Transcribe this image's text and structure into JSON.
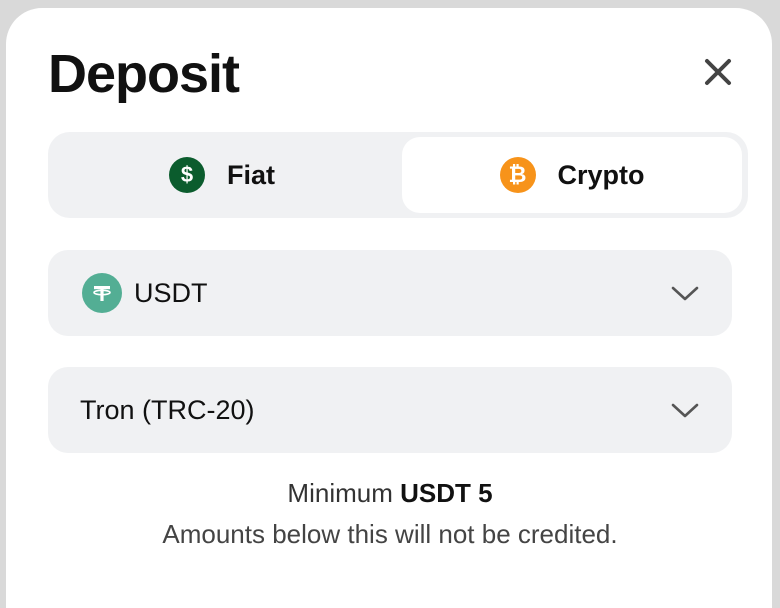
{
  "header": {
    "title": "Deposit"
  },
  "tabs": [
    {
      "label": "Fiat",
      "icon": "dollar-coin-icon",
      "active": false,
      "icon_color": "#0b5c2d",
      "icon_glyph": "$"
    },
    {
      "label": "Crypto",
      "icon": "bitcoin-icon",
      "active": true,
      "icon_color": "#f7931a",
      "icon_glyph": "₿"
    }
  ],
  "asset_select": {
    "value": "USDT",
    "icon": "tether-icon",
    "icon_color": "#53ae94"
  },
  "network_select": {
    "value": "Tron (TRC-20)"
  },
  "info": {
    "minimum_prefix": "Minimum",
    "minimum_value": "USDT 5",
    "note": "Amounts below this will not be credited."
  }
}
